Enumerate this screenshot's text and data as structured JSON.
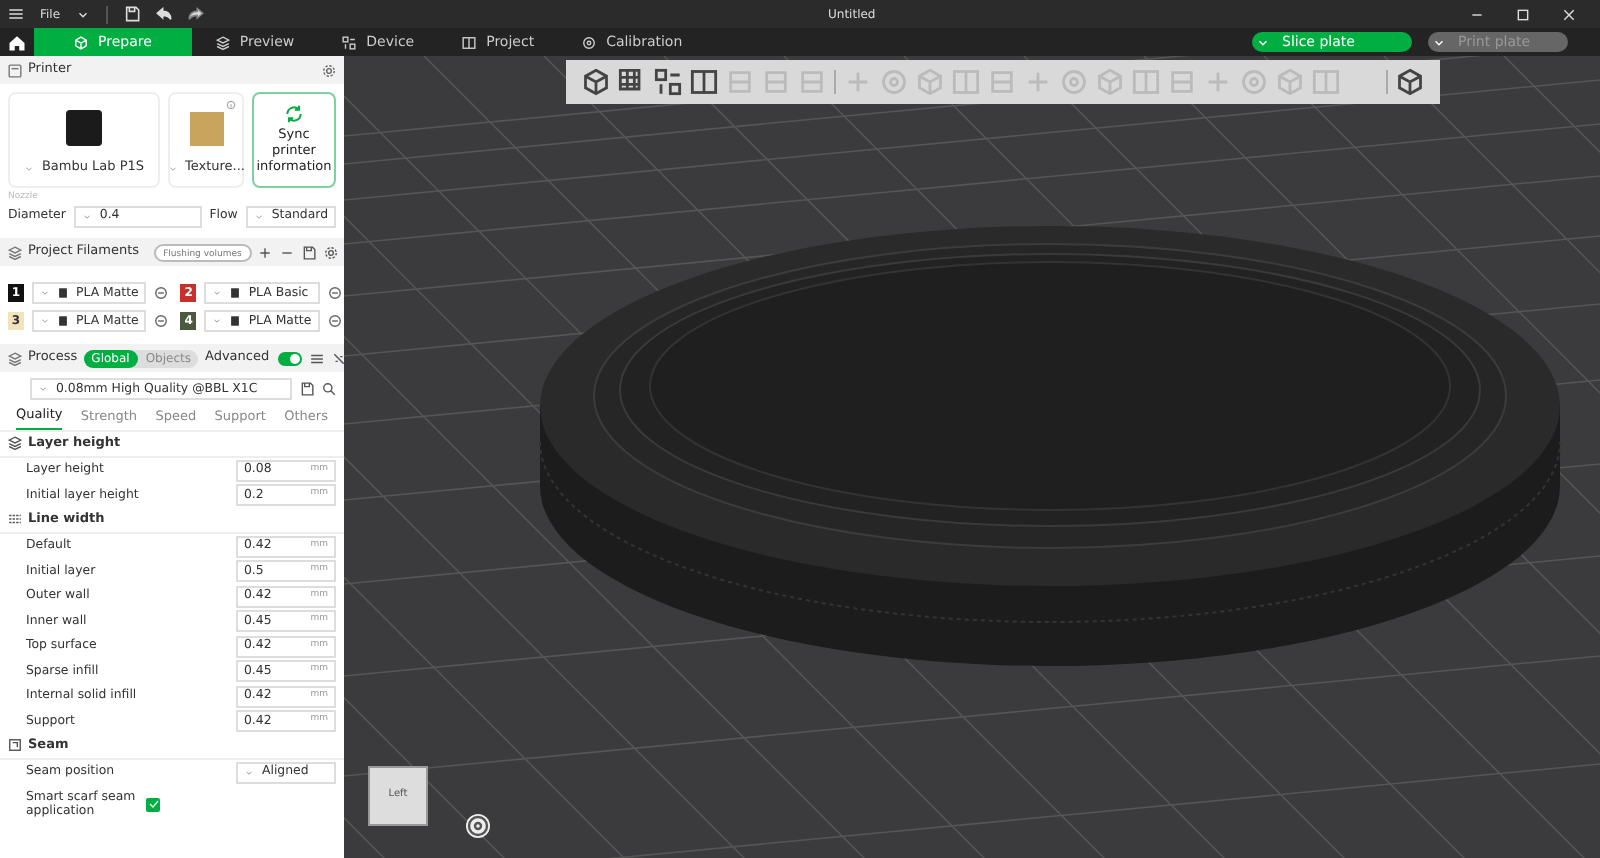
{
  "title_bar": {
    "menu": "File",
    "title": "Untitled"
  },
  "tabs": [
    {
      "label": "Prepare",
      "selected": true
    },
    {
      "label": "Preview",
      "selected": false
    },
    {
      "label": "Device",
      "selected": false
    },
    {
      "label": "Project",
      "selected": false
    },
    {
      "label": "Calibration",
      "selected": false
    }
  ],
  "actions": [
    {
      "label": "Slice plate",
      "disabled": false
    },
    {
      "label": "Print plate",
      "disabled": true
    }
  ],
  "printer": {
    "title": "Printer",
    "name": "Bambu Lab P1S",
    "plate": "Texture...",
    "sync": "Sync printer information",
    "nozzle_label": "Nozzle",
    "diameter": {
      "label": "Diameter",
      "value": "0.4"
    },
    "flow": {
      "label": "Flow",
      "value": "Standard"
    }
  },
  "filaments": {
    "title": "Project Filaments",
    "flushing": "Flushing volumes",
    "items": [
      {
        "number": "1",
        "color": "#111111",
        "name": "PLA Matte"
      },
      {
        "number": "2",
        "color": "#c8302a",
        "name": "PLA Basic"
      },
      {
        "number": "3",
        "color": "#f1e4bd",
        "name": "PLA Matte"
      },
      {
        "number": "4",
        "color": "#4b5a3c",
        "name": "PLA Matte"
      }
    ]
  },
  "process": {
    "title": "Process",
    "scope": [
      {
        "label": "Global",
        "selected": true
      },
      {
        "label": "Objects",
        "selected": false
      }
    ],
    "advanced": {
      "label": "Advanced",
      "on": true
    },
    "preset": "0.08mm High Quality @BBL X1C",
    "tabs": [
      {
        "label": "Quality",
        "selected": true
      },
      {
        "label": "Strength",
        "selected": false
      },
      {
        "label": "Speed",
        "selected": false
      },
      {
        "label": "Support",
        "selected": false
      },
      {
        "label": "Others",
        "selected": false
      }
    ]
  },
  "groups": [
    {
      "title": "Layer height",
      "rows": [
        {
          "kind": "number",
          "label": "Layer height",
          "value": "0.08",
          "unit": "mm"
        },
        {
          "kind": "number",
          "label": "Initial layer height",
          "value": "0.2",
          "unit": "mm"
        }
      ]
    },
    {
      "title": "Line width",
      "rows": [
        {
          "kind": "number",
          "label": "Default",
          "value": "0.42",
          "unit": "mm"
        },
        {
          "kind": "number",
          "label": "Initial layer",
          "value": "0.5",
          "unit": "mm"
        },
        {
          "kind": "number",
          "label": "Outer wall",
          "value": "0.42",
          "unit": "mm"
        },
        {
          "kind": "number",
          "label": "Inner wall",
          "value": "0.45",
          "unit": "mm"
        },
        {
          "kind": "number",
          "label": "Top surface",
          "value": "0.42",
          "unit": "mm"
        },
        {
          "kind": "number",
          "label": "Sparse infill",
          "value": "0.45",
          "unit": "mm"
        },
        {
          "kind": "number",
          "label": "Internal solid infill",
          "value": "0.42",
          "unit": "mm"
        },
        {
          "kind": "number",
          "label": "Support",
          "value": "0.42",
          "unit": "mm"
        }
      ]
    },
    {
      "title": "Seam",
      "rows": [
        {
          "kind": "select",
          "label": "Seam position",
          "value": "Aligned"
        },
        {
          "kind": "checkbox",
          "label": "Smart scarf seam application",
          "checked": true
        }
      ]
    }
  ],
  "viewport": {
    "cube_face": "Left"
  }
}
